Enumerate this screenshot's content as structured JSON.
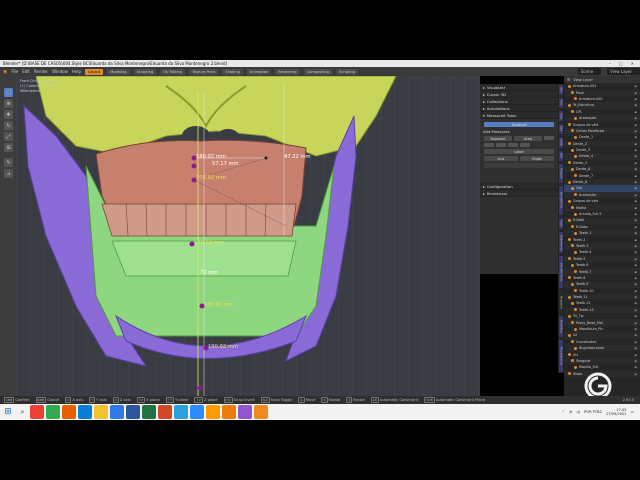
{
  "window": {
    "title": "Blender* [D:\\BASE DE CASOS\\004.Style BC\\Eduarda da Silva Montenegro\\Eduarda da Silva Montenegro 2.blend]",
    "controls": [
      "–",
      "□",
      "✕"
    ]
  },
  "menu": {
    "items": [
      "File",
      "Edit",
      "Render",
      "Window",
      "Help"
    ],
    "workspaces": [
      "Layout",
      "Modeling",
      "Sculpting",
      "UV Editing",
      "Texture Paint",
      "Shading",
      "Animation",
      "Rendering",
      "Compositing",
      "Scripting"
    ],
    "active_workspace": "Layout",
    "scene_label": "Scene",
    "view_layer_label": "View Layer"
  },
  "viewport": {
    "view_name": "Front Orthographic",
    "collection": "(1) Collection | mss",
    "units": "Millimeters",
    "measurements": {
      "m1": "180.02 mm",
      "m2": "57.17 mm",
      "m3": "47.22 mm",
      "m4": "108.92 mm",
      "m5": "190.02 mm",
      "m6": "72 mm",
      "m7": "180.92 mm",
      "m8": "190.02 mm"
    }
  },
  "npanel": {
    "sections": [
      "Visualizar",
      "Cursor 3D",
      "Collections",
      "Annotations",
      "Measureit Tools"
    ],
    "selected_button": "Distance",
    "sub_header": "Add Measures",
    "buttons": [
      "Segment",
      "Area",
      "Label",
      "Link",
      "Origin"
    ],
    "sections2": [
      "Configuration",
      "Renderizar"
    ],
    "vtabs": [
      "Item",
      "Tool",
      "View",
      "Edit",
      "Orbit",
      "Edit",
      "Teleport",
      "BioAdd/Tools",
      "Teeth",
      "MakeHuman",
      "BlendWI Tools",
      "Measureit",
      "Modelling",
      "Miscellaneous"
    ]
  },
  "outliner": {
    "header": "View Layer",
    "items": [
      "Armature.001",
      "Pose",
      "Armature.000",
      "Te_Estrutura",
      "CPL",
      "Aramação",
      "Grupos de vért",
      "Cintas Modificad",
      "Dente_1",
      "Dente_2",
      "Dente_3",
      "Dente_4",
      "Dente_5",
      "Dente_6",
      "Dente_7",
      "Dente_8",
      "Obj",
      "Aramação",
      "Grupos de vért",
      "Malha",
      "Arcada_Full.5",
      "R.Dobl",
      "R.Dobs",
      "Teeth.1",
      "Teeth.2",
      "Teeth.3",
      "Teeth.4",
      "Teeth.5",
      "Teeth.6",
      "Teeth.7",
      "Teeth.8",
      "Teeth.9",
      "Teeth.10",
      "Teeth.11",
      "Teeth.12",
      "Teeth.13",
      "Tri_Tip",
      "Proxy_Base_Mal",
      "Mandíbula_Pln",
      "v2",
      "Coordinates",
      "Ânguloscranial",
      "Iris",
      "Ssogular",
      "Maxilla_Full",
      "Visao"
    ],
    "selected_index": 16
  },
  "statusbar": {
    "items": [
      {
        "key": "LMB",
        "label": "Confirm"
      },
      {
        "key": "RMB",
        "label": "Cancel"
      },
      {
        "key": "X",
        "label": "X axis"
      },
      {
        "key": "Y",
        "label": "Y axis"
      },
      {
        "key": "Z",
        "label": "Z axis"
      },
      {
        "key": "⇧X",
        "label": "X plane"
      },
      {
        "key": "⇧Y",
        "label": "Y plane"
      },
      {
        "key": "⇧Z",
        "label": "Z plane"
      },
      {
        "key": "Ctrl",
        "label": "Snap Invert"
      },
      {
        "key": "Tab",
        "label": "Snap Toggle"
      },
      {
        "key": "G",
        "label": "Move"
      },
      {
        "key": "R",
        "label": "Rotate"
      },
      {
        "key": "S",
        "label": "Resize"
      },
      {
        "key": "Alt",
        "label": "Automatic Constraint"
      },
      {
        "key": "Shift",
        "label": "Automatic Constraint Plane"
      }
    ],
    "version": "2.93.0"
  },
  "taskbar": {
    "apps": [
      "Chrome",
      "Chrome",
      "Firefox",
      "Edge",
      "Explorer",
      "Photos",
      "Word",
      "Excel",
      "PowerPoint",
      "Telegram",
      "Zoom",
      "Illustrator",
      "Blender",
      "Paint",
      "VLC"
    ],
    "app_colors": [
      "#ea4335",
      "#34a853",
      "#e66000",
      "#0a7cd4",
      "#f2c230",
      "#2f7ae5",
      "#2b579a",
      "#217346",
      "#d24726",
      "#2aa1d8",
      "#2d8cff",
      "#ff9a00",
      "#e87d0d",
      "#8f57c9",
      "#f08a24"
    ],
    "lang": "POR PTB2",
    "time": "17:05",
    "date": "17/05/2022"
  },
  "colors": {
    "accent": "#e08a2b",
    "skull": "#c7d65a",
    "maxilla": "#c7806e",
    "mandible_green": "#8fd681",
    "mandible_purple": "#8a6ad6",
    "measure_dot": "#8a1d8a"
  }
}
